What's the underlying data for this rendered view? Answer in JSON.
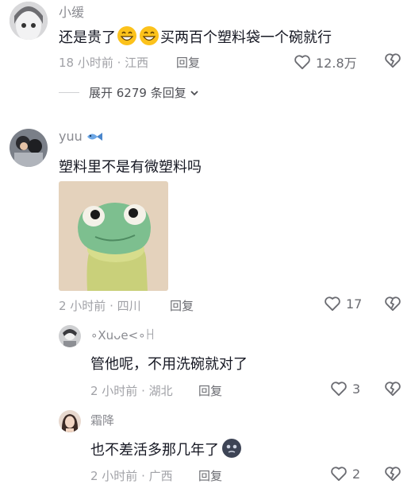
{
  "comments": [
    {
      "user": "小缓",
      "text_before": "还是贵了",
      "emojis": [
        "grinning-face",
        "grinning-face"
      ],
      "text_after": "买两百个塑料袋一个碗就行",
      "time_location": "18 小时前 · 江西",
      "reply_label": "回复",
      "likes": "12.8万",
      "expand": {
        "label": "展开 6279 条回复",
        "chevron": "chevron-down-icon"
      }
    },
    {
      "user": "yuu",
      "user_badge": "fish-icon",
      "text": "塑料里不是有微塑料吗",
      "image": "frog-sticker",
      "time_location": "2 小时前 · 四川",
      "reply_label": "回复",
      "likes": "17"
    }
  ],
  "replies": [
    {
      "user": "∘Xuᴗe<∘ꀿ",
      "text": "管他呢，不用洗碗就对了",
      "time_location": "2 小时前 · 湖北",
      "reply_label": "回复",
      "likes": "3"
    },
    {
      "user": "霜降",
      "text": "也不差活多那几年了",
      "emoji": "dark-blob-face",
      "time_location": "2 小时前 · 广西",
      "reply_label": "回复",
      "likes": "2"
    }
  ],
  "colors": {
    "text": "#161823",
    "secondary": "#8a8b91",
    "meta": "#a1a2a7",
    "icon": "#6b6c72"
  }
}
